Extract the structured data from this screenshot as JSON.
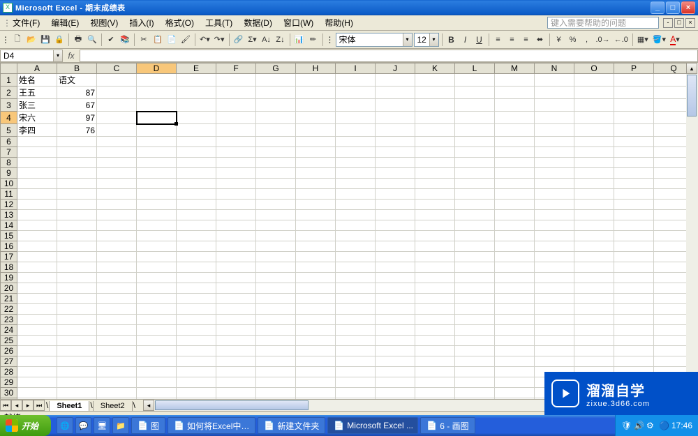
{
  "title": "Microsoft Excel - 期末成绩表",
  "menu": [
    "文件(F)",
    "编辑(E)",
    "视图(V)",
    "插入(I)",
    "格式(O)",
    "工具(T)",
    "数据(D)",
    "窗口(W)",
    "帮助(H)"
  ],
  "help_placeholder": "键入需要帮助的问题",
  "font": {
    "name": "宋体",
    "size": "12"
  },
  "namebox": "D4",
  "formula": "",
  "columns": [
    "A",
    "B",
    "C",
    "D",
    "E",
    "F",
    "G",
    "H",
    "I",
    "J",
    "K",
    "L",
    "M",
    "N",
    "O",
    "P",
    "Q"
  ],
  "selected_col": "D",
  "selected_row": 4,
  "rows_shown": 32,
  "sheet_data": {
    "headers": [
      "姓名",
      "语文"
    ],
    "rows": [
      {
        "name": "王五",
        "score": 87
      },
      {
        "name": "张三",
        "score": 67
      },
      {
        "name": "宋六",
        "score": 97
      },
      {
        "name": "李四",
        "score": 76
      }
    ]
  },
  "sheets": [
    "Sheet1",
    "Sheet2"
  ],
  "active_sheet": "Sheet1",
  "status": "就绪",
  "taskbar": {
    "start": "开始",
    "items": [
      {
        "label": "图"
      },
      {
        "label": "如何将Excel中…"
      },
      {
        "label": "新建文件夹"
      },
      {
        "label": "Microsoft Excel ...",
        "active": true
      },
      {
        "label": "6 - 画图"
      }
    ],
    "time": "17:46"
  },
  "watermark": {
    "line1": "溜溜自学",
    "line2": "zixue.3d66.com"
  }
}
